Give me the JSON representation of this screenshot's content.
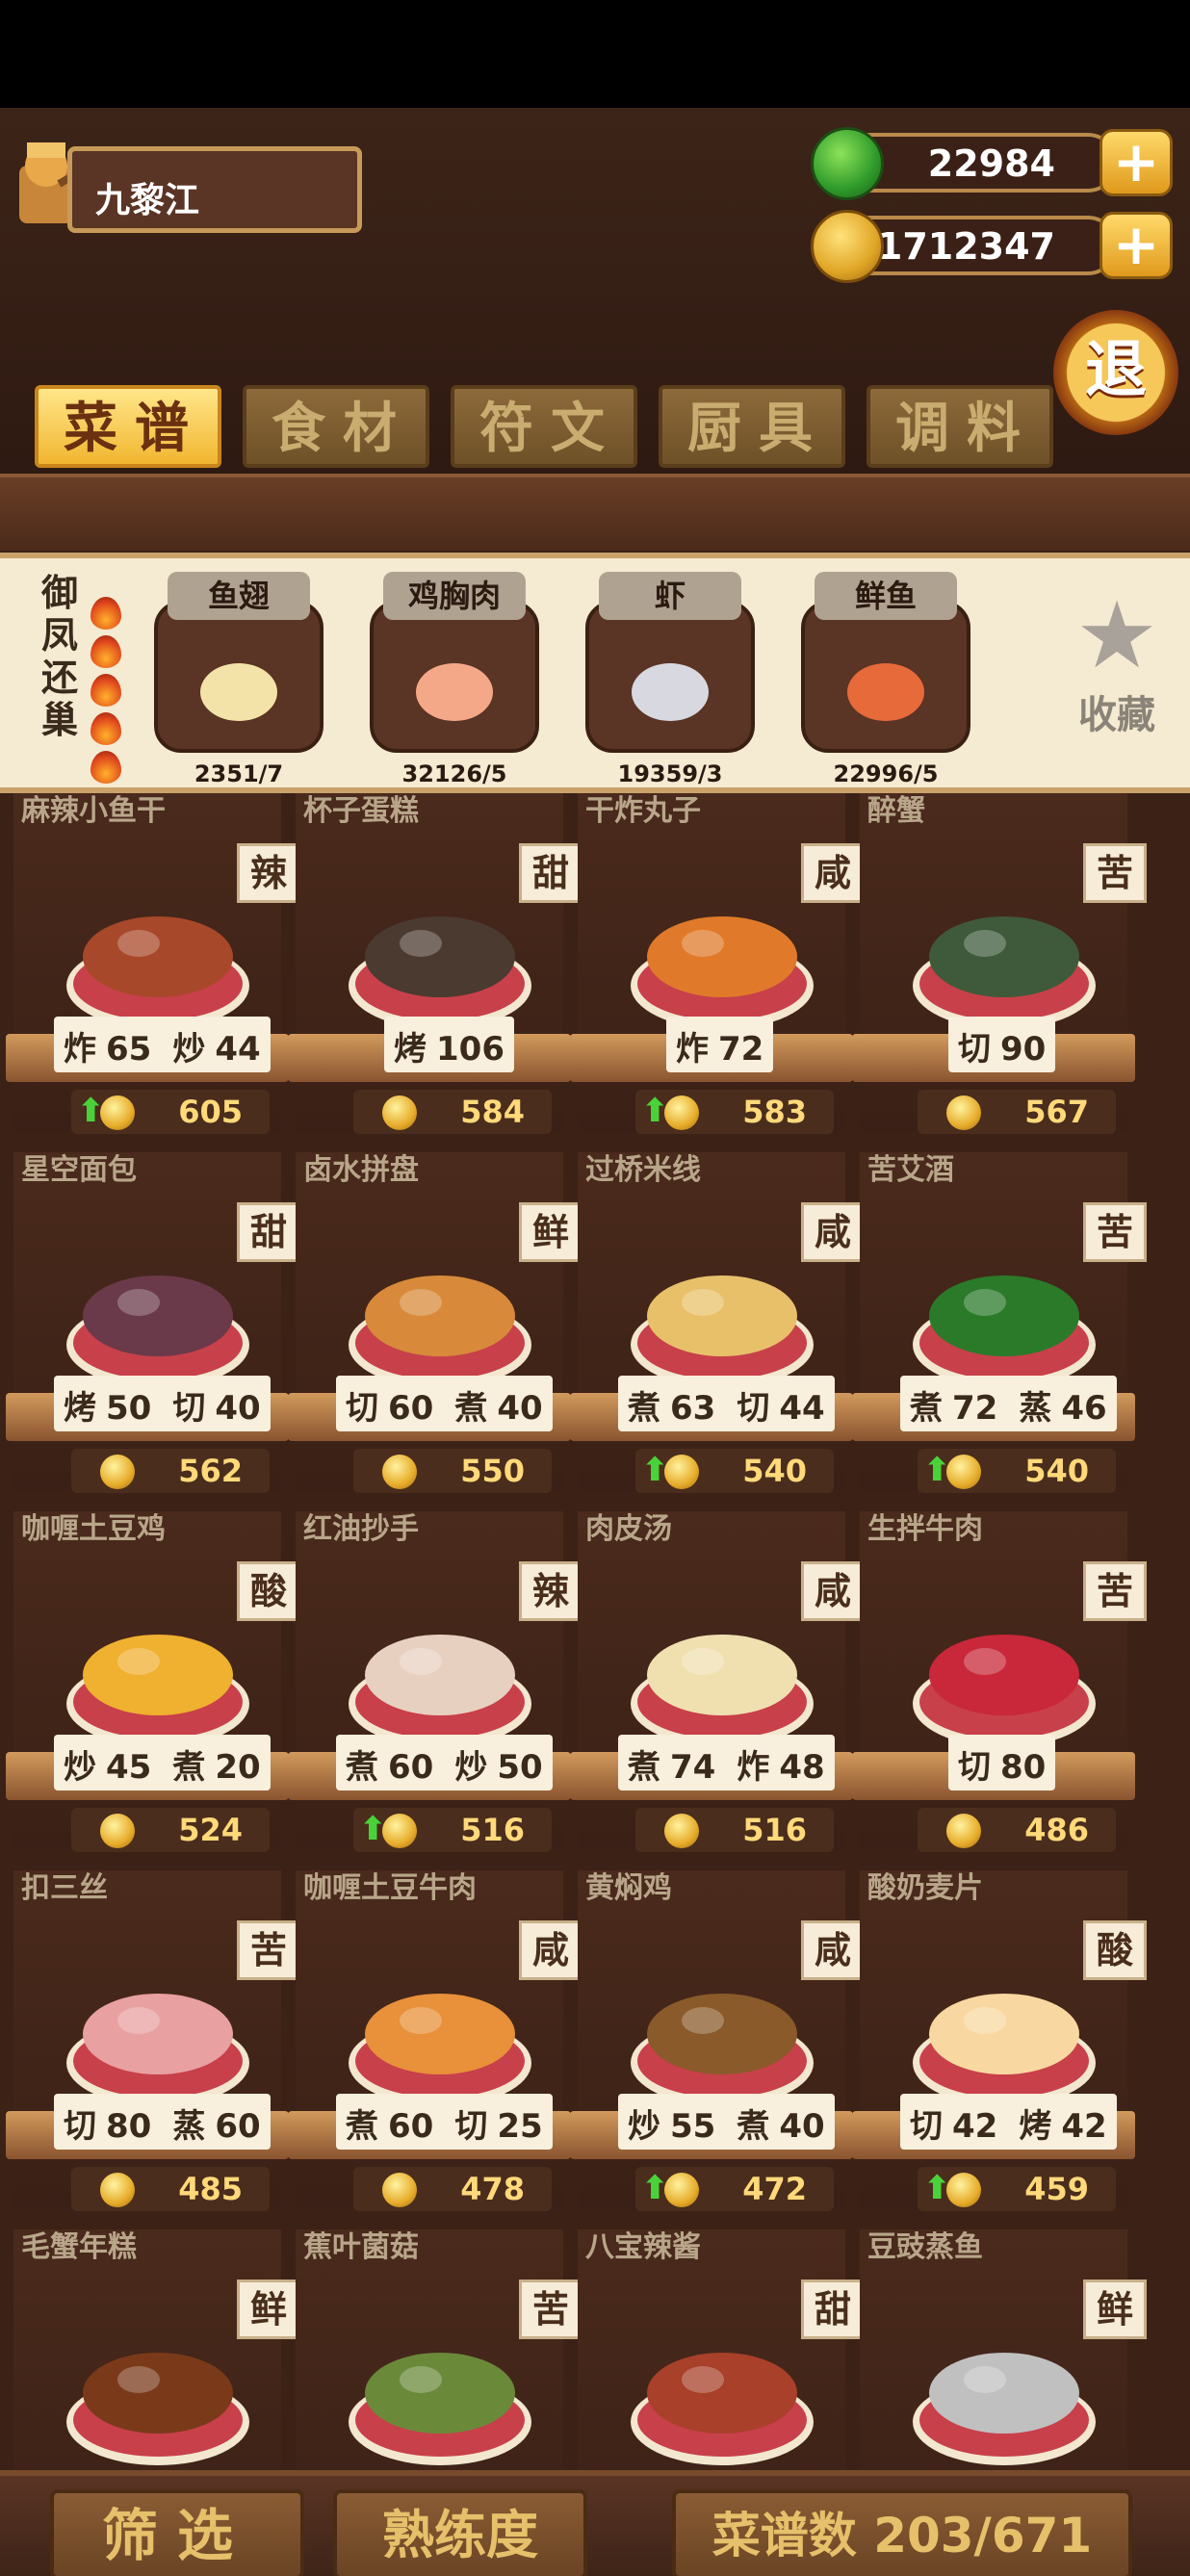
{
  "player": {
    "name": "九黎江"
  },
  "currency": {
    "jade": "22984",
    "gold": "1712347",
    "plus": "+"
  },
  "back_label": "退",
  "tabs": [
    {
      "label": "菜谱",
      "active": true
    },
    {
      "label": "食材",
      "active": false
    },
    {
      "label": "符文",
      "active": false
    },
    {
      "label": "厨具",
      "active": false
    },
    {
      "label": "调料",
      "active": false
    }
  ],
  "set": {
    "name": "御凤还巢",
    "ingredients": [
      {
        "label": "鱼翅",
        "count": "2351/7",
        "icon": "shark-fin-icon"
      },
      {
        "label": "鸡胸肉",
        "count": "32126/5",
        "icon": "chicken-breast-icon"
      },
      {
        "label": "虾",
        "count": "19359/3",
        "icon": "shrimp-icon"
      },
      {
        "label": "鲜鱼",
        "count": "22996/5",
        "icon": "fish-icon"
      }
    ],
    "favorite_label": "收藏"
  },
  "recipes": [
    {
      "name": "麻辣小鱼干",
      "flavor": "辣",
      "skills": [
        [
          "炸",
          "65"
        ],
        [
          "炒",
          "44"
        ]
      ],
      "price": "605",
      "up": true
    },
    {
      "name": "杯子蛋糕",
      "flavor": "甜",
      "skills": [
        [
          "烤",
          "106"
        ]
      ],
      "price": "584",
      "up": false
    },
    {
      "name": "干炸丸子",
      "flavor": "咸",
      "skills": [
        [
          "炸",
          "72"
        ]
      ],
      "price": "583",
      "up": true
    },
    {
      "name": "醉蟹",
      "flavor": "苦",
      "skills": [
        [
          "切",
          "90"
        ]
      ],
      "price": "567",
      "up": false
    },
    {
      "name": "星空面包",
      "flavor": "甜",
      "skills": [
        [
          "烤",
          "50"
        ],
        [
          "切",
          "40"
        ]
      ],
      "price": "562",
      "up": false
    },
    {
      "name": "卤水拼盘",
      "flavor": "鲜",
      "skills": [
        [
          "切",
          "60"
        ],
        [
          "煮",
          "40"
        ]
      ],
      "price": "550",
      "up": false
    },
    {
      "name": "过桥米线",
      "flavor": "咸",
      "skills": [
        [
          "煮",
          "63"
        ],
        [
          "切",
          "44"
        ]
      ],
      "price": "540",
      "up": true
    },
    {
      "name": "苦艾酒",
      "flavor": "苦",
      "skills": [
        [
          "煮",
          "72"
        ],
        [
          "蒸",
          "46"
        ]
      ],
      "price": "540",
      "up": true
    },
    {
      "name": "咖喱土豆鸡",
      "flavor": "酸",
      "skills": [
        [
          "炒",
          "45"
        ],
        [
          "煮",
          "20"
        ]
      ],
      "price": "524",
      "up": false
    },
    {
      "name": "红油抄手",
      "flavor": "辣",
      "skills": [
        [
          "煮",
          "60"
        ],
        [
          "炒",
          "50"
        ]
      ],
      "price": "516",
      "up": true
    },
    {
      "name": "肉皮汤",
      "flavor": "咸",
      "skills": [
        [
          "煮",
          "74"
        ],
        [
          "炸",
          "48"
        ]
      ],
      "price": "516",
      "up": false
    },
    {
      "name": "生拌牛肉",
      "flavor": "苦",
      "skills": [
        [
          "切",
          "80"
        ]
      ],
      "price": "486",
      "up": false
    },
    {
      "name": "扣三丝",
      "flavor": "苦",
      "skills": [
        [
          "切",
          "80"
        ],
        [
          "蒸",
          "60"
        ]
      ],
      "price": "485",
      "up": false
    },
    {
      "name": "咖喱土豆牛肉",
      "flavor": "咸",
      "skills": [
        [
          "煮",
          "60"
        ],
        [
          "切",
          "25"
        ]
      ],
      "price": "478",
      "up": false
    },
    {
      "name": "黄焖鸡",
      "flavor": "咸",
      "skills": [
        [
          "炒",
          "55"
        ],
        [
          "煮",
          "40"
        ]
      ],
      "price": "472",
      "up": true
    },
    {
      "name": "酸奶麦片",
      "flavor": "酸",
      "skills": [
        [
          "切",
          "42"
        ],
        [
          "烤",
          "42"
        ]
      ],
      "price": "459",
      "up": true
    },
    {
      "name": "毛蟹年糕",
      "flavor": "鲜",
      "skills": [],
      "price": "",
      "up": false
    },
    {
      "name": "蕉叶菌菇",
      "flavor": "苦",
      "skills": [],
      "price": "",
      "up": false
    },
    {
      "name": "八宝辣酱",
      "flavor": "甜",
      "skills": [],
      "price": "",
      "up": false
    },
    {
      "name": "豆豉蒸鱼",
      "flavor": "鲜",
      "skills": [],
      "price": "",
      "up": false
    }
  ],
  "bottom": {
    "filter": "筛选",
    "proficiency": "熟练度",
    "recipe_count": "菜谱数 203/671"
  }
}
